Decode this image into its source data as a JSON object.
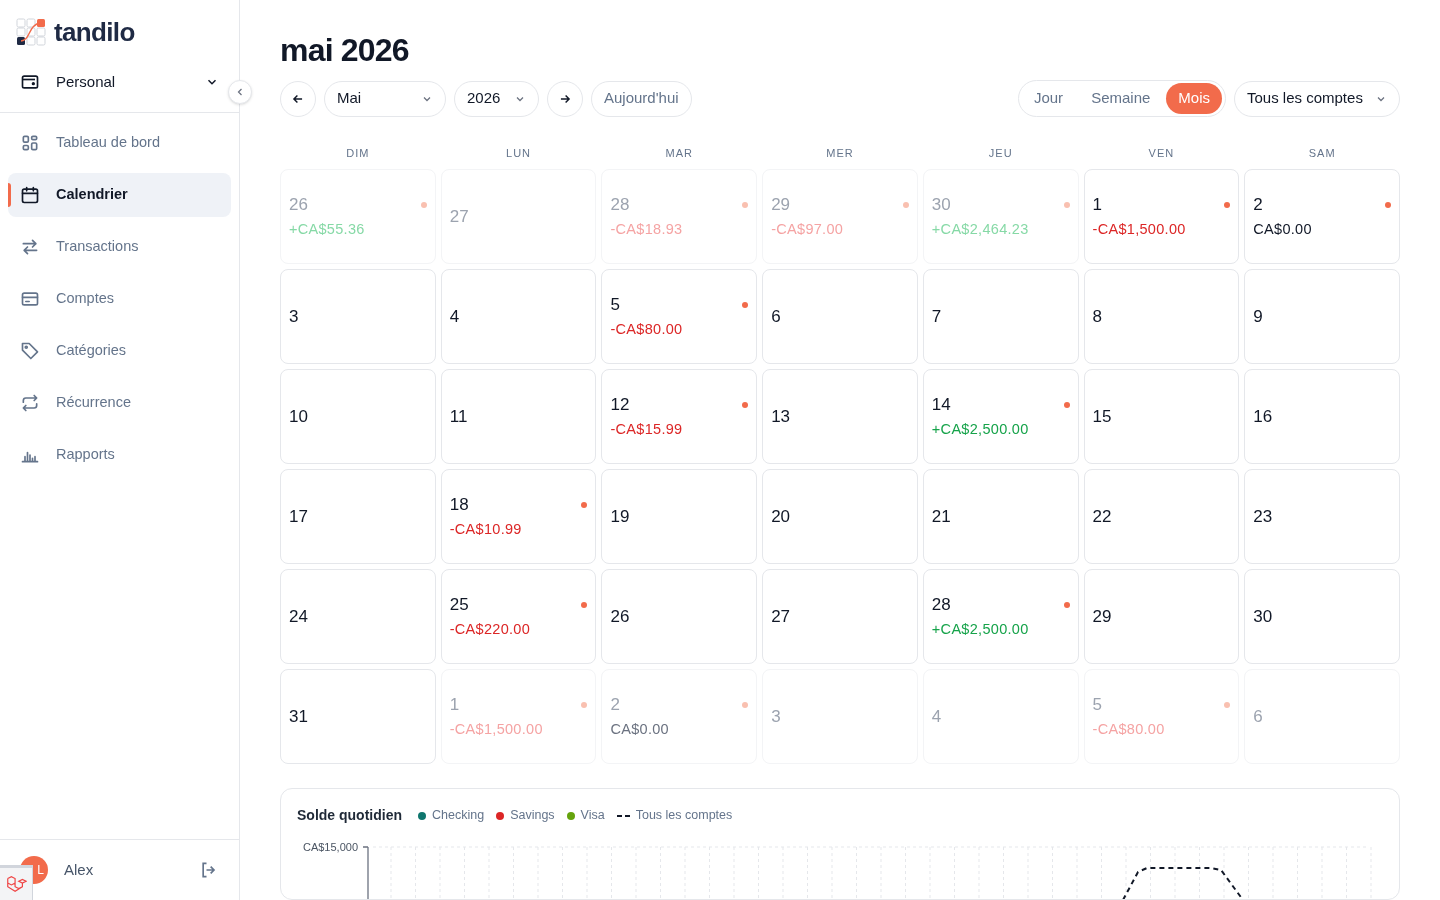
{
  "brand": {
    "name": "tandilo"
  },
  "workspace": {
    "label": "Personal"
  },
  "nav": [
    {
      "label": "Tableau de bord",
      "selected": false
    },
    {
      "label": "Calendrier",
      "selected": true
    },
    {
      "label": "Transactions",
      "selected": false
    },
    {
      "label": "Comptes",
      "selected": false
    },
    {
      "label": "Catégories",
      "selected": false
    },
    {
      "label": "Récurrence",
      "selected": false
    },
    {
      "label": "Rapports",
      "selected": false
    }
  ],
  "user": {
    "initials": "L",
    "name": "Alex"
  },
  "title": "mai 2026",
  "toolbar": {
    "month": "Mai",
    "year": "2026",
    "today": "Aujourd'hui",
    "account_filter": "Tous les comptes"
  },
  "views": [
    {
      "label": "Jour",
      "selected": false
    },
    {
      "label": "Semaine",
      "selected": false
    },
    {
      "label": "Mois",
      "selected": true
    }
  ],
  "weekdays": [
    "DIM",
    "LUN",
    "MAR",
    "MER",
    "JEU",
    "VEN",
    "SAM"
  ],
  "days": [
    {
      "day": "26",
      "in_month": false,
      "amount": "+CA$55.36",
      "kind": "income"
    },
    {
      "day": "27",
      "in_month": false
    },
    {
      "day": "28",
      "in_month": false,
      "amount": "-CA$18.93",
      "kind": "expense"
    },
    {
      "day": "29",
      "in_month": false,
      "amount": "-CA$97.00",
      "kind": "expense"
    },
    {
      "day": "30",
      "in_month": false,
      "amount": "+CA$2,464.23",
      "kind": "income"
    },
    {
      "day": "1",
      "in_month": true,
      "amount": "-CA$1,500.00",
      "kind": "expense"
    },
    {
      "day": "2",
      "in_month": true,
      "amount": "CA$0.00",
      "kind": "neutral"
    },
    {
      "day": "3",
      "in_month": true
    },
    {
      "day": "4",
      "in_month": true
    },
    {
      "day": "5",
      "in_month": true,
      "amount": "-CA$80.00",
      "kind": "expense"
    },
    {
      "day": "6",
      "in_month": true
    },
    {
      "day": "7",
      "in_month": true
    },
    {
      "day": "8",
      "in_month": true
    },
    {
      "day": "9",
      "in_month": true
    },
    {
      "day": "10",
      "in_month": true
    },
    {
      "day": "11",
      "in_month": true
    },
    {
      "day": "12",
      "in_month": true,
      "amount": "-CA$15.99",
      "kind": "expense"
    },
    {
      "day": "13",
      "in_month": true
    },
    {
      "day": "14",
      "in_month": true,
      "amount": "+CA$2,500.00",
      "kind": "income"
    },
    {
      "day": "15",
      "in_month": true
    },
    {
      "day": "16",
      "in_month": true
    },
    {
      "day": "17",
      "in_month": true
    },
    {
      "day": "18",
      "in_month": true,
      "amount": "-CA$10.99",
      "kind": "expense"
    },
    {
      "day": "19",
      "in_month": true
    },
    {
      "day": "20",
      "in_month": true
    },
    {
      "day": "21",
      "in_month": true
    },
    {
      "day": "22",
      "in_month": true
    },
    {
      "day": "23",
      "in_month": true
    },
    {
      "day": "24",
      "in_month": true
    },
    {
      "day": "25",
      "in_month": true,
      "amount": "-CA$220.00",
      "kind": "expense"
    },
    {
      "day": "26",
      "in_month": true
    },
    {
      "day": "27",
      "in_month": true
    },
    {
      "day": "28",
      "in_month": true,
      "amount": "+CA$2,500.00",
      "kind": "income"
    },
    {
      "day": "29",
      "in_month": true
    },
    {
      "day": "30",
      "in_month": true
    },
    {
      "day": "31",
      "in_month": true
    },
    {
      "day": "1",
      "in_month": false,
      "amount": "-CA$1,500.00",
      "kind": "expense"
    },
    {
      "day": "2",
      "in_month": false,
      "amount": "CA$0.00",
      "kind": "neutral"
    },
    {
      "day": "3",
      "in_month": false
    },
    {
      "day": "4",
      "in_month": false
    },
    {
      "day": "5",
      "in_month": false,
      "amount": "-CA$80.00",
      "kind": "expense"
    },
    {
      "day": "6",
      "in_month": false
    }
  ],
  "balance_chart": {
    "title": "Solde quotidien",
    "legend": [
      {
        "label": "Checking",
        "kind": "dot",
        "color": "#0f766e"
      },
      {
        "label": "Savings",
        "kind": "dot",
        "color": "#dc2626"
      },
      {
        "label": "Visa",
        "kind": "dot",
        "color": "#65a30d"
      },
      {
        "label": "Tous les comptes",
        "kind": "dash",
        "color": "#111827"
      }
    ],
    "y_tick": "CA$15,000"
  }
}
